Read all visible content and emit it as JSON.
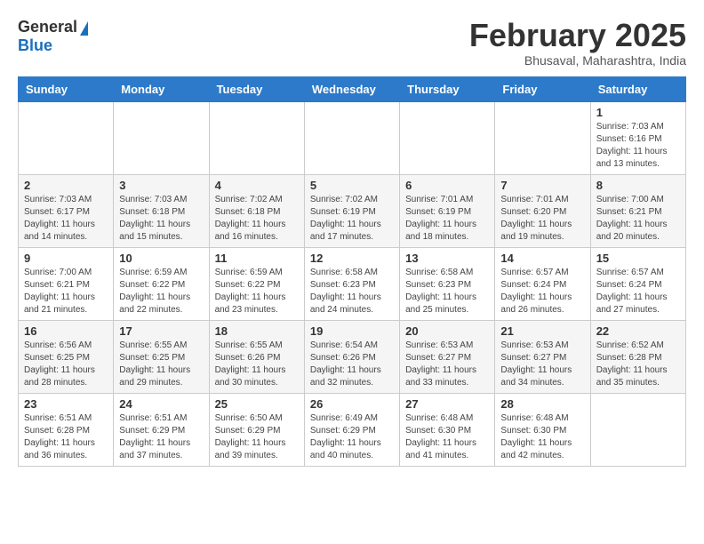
{
  "header": {
    "logo_general": "General",
    "logo_blue": "Blue",
    "month_title": "February 2025",
    "subtitle": "Bhusaval, Maharashtra, India"
  },
  "weekdays": [
    "Sunday",
    "Monday",
    "Tuesday",
    "Wednesday",
    "Thursday",
    "Friday",
    "Saturday"
  ],
  "weeks": [
    [
      {
        "day": "",
        "info": ""
      },
      {
        "day": "",
        "info": ""
      },
      {
        "day": "",
        "info": ""
      },
      {
        "day": "",
        "info": ""
      },
      {
        "day": "",
        "info": ""
      },
      {
        "day": "",
        "info": ""
      },
      {
        "day": "1",
        "info": "Sunrise: 7:03 AM\nSunset: 6:16 PM\nDaylight: 11 hours\nand 13 minutes."
      }
    ],
    [
      {
        "day": "2",
        "info": "Sunrise: 7:03 AM\nSunset: 6:17 PM\nDaylight: 11 hours\nand 14 minutes."
      },
      {
        "day": "3",
        "info": "Sunrise: 7:03 AM\nSunset: 6:18 PM\nDaylight: 11 hours\nand 15 minutes."
      },
      {
        "day": "4",
        "info": "Sunrise: 7:02 AM\nSunset: 6:18 PM\nDaylight: 11 hours\nand 16 minutes."
      },
      {
        "day": "5",
        "info": "Sunrise: 7:02 AM\nSunset: 6:19 PM\nDaylight: 11 hours\nand 17 minutes."
      },
      {
        "day": "6",
        "info": "Sunrise: 7:01 AM\nSunset: 6:19 PM\nDaylight: 11 hours\nand 18 minutes."
      },
      {
        "day": "7",
        "info": "Sunrise: 7:01 AM\nSunset: 6:20 PM\nDaylight: 11 hours\nand 19 minutes."
      },
      {
        "day": "8",
        "info": "Sunrise: 7:00 AM\nSunset: 6:21 PM\nDaylight: 11 hours\nand 20 minutes."
      }
    ],
    [
      {
        "day": "9",
        "info": "Sunrise: 7:00 AM\nSunset: 6:21 PM\nDaylight: 11 hours\nand 21 minutes."
      },
      {
        "day": "10",
        "info": "Sunrise: 6:59 AM\nSunset: 6:22 PM\nDaylight: 11 hours\nand 22 minutes."
      },
      {
        "day": "11",
        "info": "Sunrise: 6:59 AM\nSunset: 6:22 PM\nDaylight: 11 hours\nand 23 minutes."
      },
      {
        "day": "12",
        "info": "Sunrise: 6:58 AM\nSunset: 6:23 PM\nDaylight: 11 hours\nand 24 minutes."
      },
      {
        "day": "13",
        "info": "Sunrise: 6:58 AM\nSunset: 6:23 PM\nDaylight: 11 hours\nand 25 minutes."
      },
      {
        "day": "14",
        "info": "Sunrise: 6:57 AM\nSunset: 6:24 PM\nDaylight: 11 hours\nand 26 minutes."
      },
      {
        "day": "15",
        "info": "Sunrise: 6:57 AM\nSunset: 6:24 PM\nDaylight: 11 hours\nand 27 minutes."
      }
    ],
    [
      {
        "day": "16",
        "info": "Sunrise: 6:56 AM\nSunset: 6:25 PM\nDaylight: 11 hours\nand 28 minutes."
      },
      {
        "day": "17",
        "info": "Sunrise: 6:55 AM\nSunset: 6:25 PM\nDaylight: 11 hours\nand 29 minutes."
      },
      {
        "day": "18",
        "info": "Sunrise: 6:55 AM\nSunset: 6:26 PM\nDaylight: 11 hours\nand 30 minutes."
      },
      {
        "day": "19",
        "info": "Sunrise: 6:54 AM\nSunset: 6:26 PM\nDaylight: 11 hours\nand 32 minutes."
      },
      {
        "day": "20",
        "info": "Sunrise: 6:53 AM\nSunset: 6:27 PM\nDaylight: 11 hours\nand 33 minutes."
      },
      {
        "day": "21",
        "info": "Sunrise: 6:53 AM\nSunset: 6:27 PM\nDaylight: 11 hours\nand 34 minutes."
      },
      {
        "day": "22",
        "info": "Sunrise: 6:52 AM\nSunset: 6:28 PM\nDaylight: 11 hours\nand 35 minutes."
      }
    ],
    [
      {
        "day": "23",
        "info": "Sunrise: 6:51 AM\nSunset: 6:28 PM\nDaylight: 11 hours\nand 36 minutes."
      },
      {
        "day": "24",
        "info": "Sunrise: 6:51 AM\nSunset: 6:29 PM\nDaylight: 11 hours\nand 37 minutes."
      },
      {
        "day": "25",
        "info": "Sunrise: 6:50 AM\nSunset: 6:29 PM\nDaylight: 11 hours\nand 39 minutes."
      },
      {
        "day": "26",
        "info": "Sunrise: 6:49 AM\nSunset: 6:29 PM\nDaylight: 11 hours\nand 40 minutes."
      },
      {
        "day": "27",
        "info": "Sunrise: 6:48 AM\nSunset: 6:30 PM\nDaylight: 11 hours\nand 41 minutes."
      },
      {
        "day": "28",
        "info": "Sunrise: 6:48 AM\nSunset: 6:30 PM\nDaylight: 11 hours\nand 42 minutes."
      },
      {
        "day": "",
        "info": ""
      }
    ]
  ]
}
